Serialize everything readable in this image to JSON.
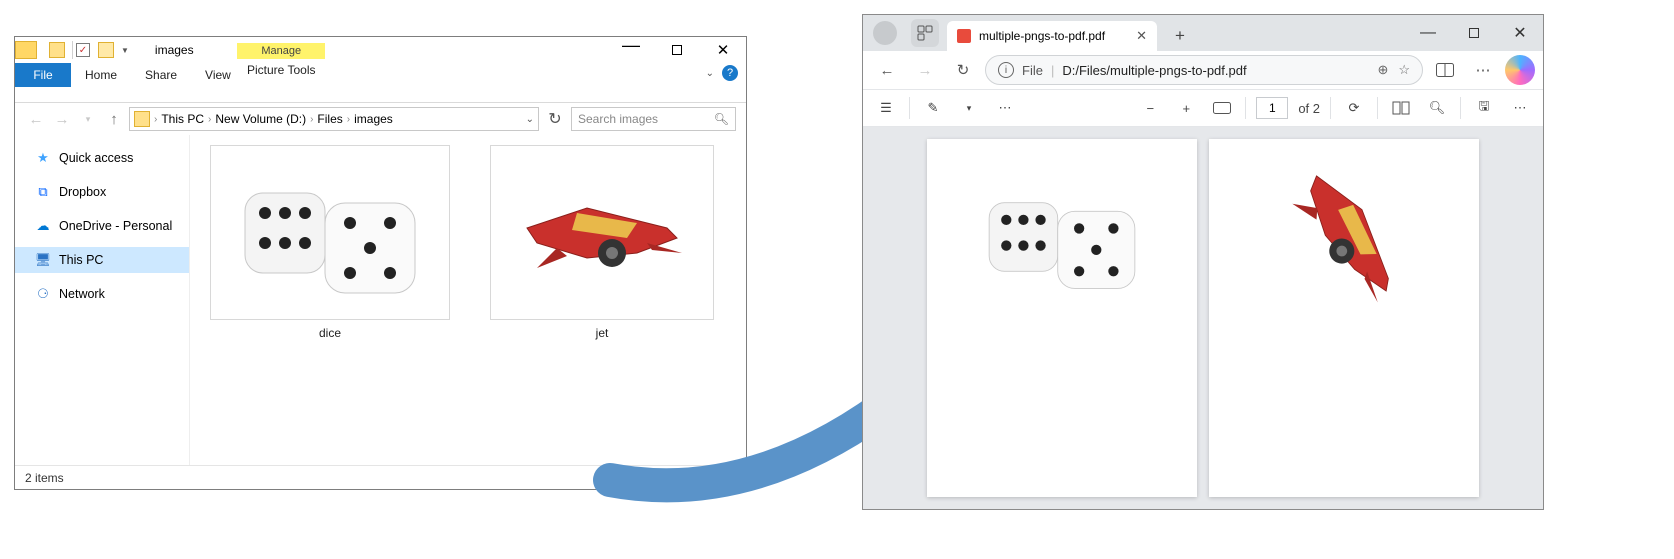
{
  "explorer": {
    "qat_title": "images",
    "ribbon": {
      "file": "File",
      "tabs": [
        "Home",
        "Share",
        "View"
      ],
      "manage": "Manage",
      "manage_sub": "Picture Tools"
    },
    "breadcrumb": [
      "This PC",
      "New Volume (D:)",
      "Files",
      "images"
    ],
    "search_placeholder": "Search images",
    "sidebar": [
      {
        "icon": "star",
        "label": "Quick access",
        "color": "#3fa3ff"
      },
      {
        "icon": "dropbox",
        "label": "Dropbox",
        "color": "#0061ff"
      },
      {
        "icon": "cloud",
        "label": "OneDrive - Personal",
        "color": "#0078d4"
      },
      {
        "icon": "pc",
        "label": "This PC",
        "color": "#2a72c4",
        "selected": true
      },
      {
        "icon": "network",
        "label": "Network",
        "color": "#2a72c4"
      }
    ],
    "files": [
      {
        "name": "dice",
        "kind": "dice"
      },
      {
        "name": "jet",
        "kind": "jet"
      }
    ],
    "status": "2 items"
  },
  "browser": {
    "tab_title": "multiple-pngs-to-pdf.pdf",
    "url_scheme": "File",
    "url_path": "D:/Files/multiple-pngs-to-pdf.pdf",
    "pdf": {
      "page_current": "1",
      "page_of": "of 2"
    }
  }
}
